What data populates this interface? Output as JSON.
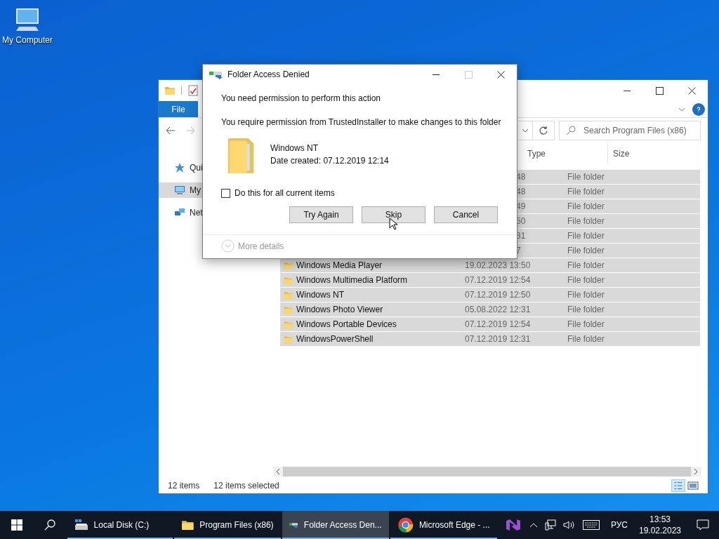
{
  "desktop": {
    "icons": [
      {
        "label": "My Computer"
      }
    ]
  },
  "explorer": {
    "ribbon_tabs": [
      {
        "label": "File"
      }
    ],
    "nav_items": [
      {
        "kind": "star",
        "label": "Qui",
        "selected": false
      },
      {
        "kind": "computer",
        "label": "My",
        "selected": true
      },
      {
        "kind": "network",
        "label": "Net",
        "selected": false
      }
    ],
    "search": {
      "placeholder": "Search Program Files (x86)"
    },
    "columns": [
      "Type",
      "Size"
    ],
    "rows": [
      {
        "date": "48",
        "type": "File folder",
        "selected": true
      },
      {
        "date": "48",
        "type": "File folder",
        "selected": true
      },
      {
        "date": "49",
        "type": "File folder",
        "selected": true
      },
      {
        "date": "50",
        "type": "File folder",
        "selected": true
      },
      {
        "date": "31",
        "type": "File folder",
        "selected": true
      },
      {
        "date": "7",
        "type": "File folder",
        "selected": true
      },
      {
        "name": "Windows Media Player",
        "date": "19.02.2023 13:50",
        "type": "File folder",
        "selected": true
      },
      {
        "name": "Windows Multimedia Platform",
        "date": "07.12.2019 12:54",
        "type": "File folder",
        "selected": true
      },
      {
        "name": "Windows NT",
        "date": "07.12.2019 12:50",
        "type": "File folder",
        "selected": true
      },
      {
        "name": "Windows Photo Viewer",
        "date": "05.08.2022 12:31",
        "type": "File folder",
        "selected": true
      },
      {
        "name": "Windows Portable Devices",
        "date": "07.12.2019 12:54",
        "type": "File folder",
        "selected": true
      },
      {
        "name": "WindowsPowerShell",
        "date": "07.12.2019 12:31",
        "type": "File folder",
        "selected": true
      }
    ],
    "status": {
      "count": "12 items",
      "selection": "12 items selected"
    }
  },
  "dialog": {
    "title": "Folder Access Denied",
    "heading": "You need permission to perform this action",
    "message": "You require permission from TrustedInstaller to make changes to this folder",
    "item_name": "Windows NT",
    "item_date": "Date created: 07.12.2019 12:14",
    "checkbox": {
      "label": "Do this for all current items",
      "checked": false
    },
    "buttons": [
      "Try Again",
      "Skip",
      "Cancel"
    ],
    "more_details": "More details"
  },
  "taskbar": {
    "items": [
      {
        "kind": "drive",
        "label": "Local Disk (C:)",
        "selected": false
      },
      {
        "kind": "folder",
        "label": "Program Files (x86)",
        "selected": false
      },
      {
        "kind": "dialog",
        "label": "Folder Access Den...",
        "selected": true
      },
      {
        "kind": "browser",
        "label": "Microsoft Edge - ...",
        "selected": false
      },
      {
        "kind": "studio",
        "selected": false
      }
    ],
    "language": "РУС",
    "time": "13:53",
    "date": "19.02.2023"
  }
}
